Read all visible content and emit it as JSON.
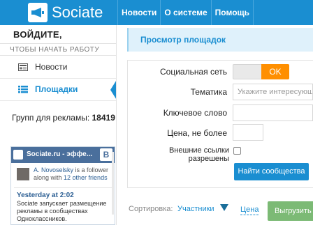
{
  "app": {
    "name": "Sociate",
    "accent": "#1a8ed1",
    "icons": [
      "megaphone-icon"
    ]
  },
  "nav": {
    "items": [
      "Новости",
      "О системе",
      "Помощь"
    ]
  },
  "sidebar": {
    "login_title": "ВОЙДИТЕ,",
    "login_subtitle": "ЧТОБЫ НАЧАТЬ РАБОТУ",
    "items": [
      {
        "label": "Новости",
        "icon": "newspaper-icon",
        "active": false
      },
      {
        "label": "Площадки",
        "icon": "list-icon",
        "active": true
      }
    ],
    "stat_label": "Групп для рекламы:",
    "stat_value": "18419"
  },
  "widget": {
    "title": "Sociate.ru - эффе...",
    "vk_badge": "B",
    "follower_name": "A. Novoselsky",
    "follower_text_1": " is a follower along with ",
    "follower_count_text": "12 other friends",
    "post_time": "Yesterday at 2:02",
    "post_text": "Sociate запускает размещение рекламы в сообществах Одноклассников."
  },
  "main": {
    "title": "Просмотр площадок",
    "form": {
      "social_label": "Социальная сеть",
      "social_value": "OK",
      "topic_label": "Тематика",
      "topic_placeholder": "Укажите интересующ",
      "keyword_label": "Ключевое слово",
      "price_label": "Цена, не более",
      "external_links_label": "Внешние ссылки разрешены",
      "submit": "Найти сообщества"
    },
    "sort": {
      "label": "Сортировка:",
      "value": "Участники",
      "price": "Цена",
      "export": "Выгрузить"
    }
  }
}
